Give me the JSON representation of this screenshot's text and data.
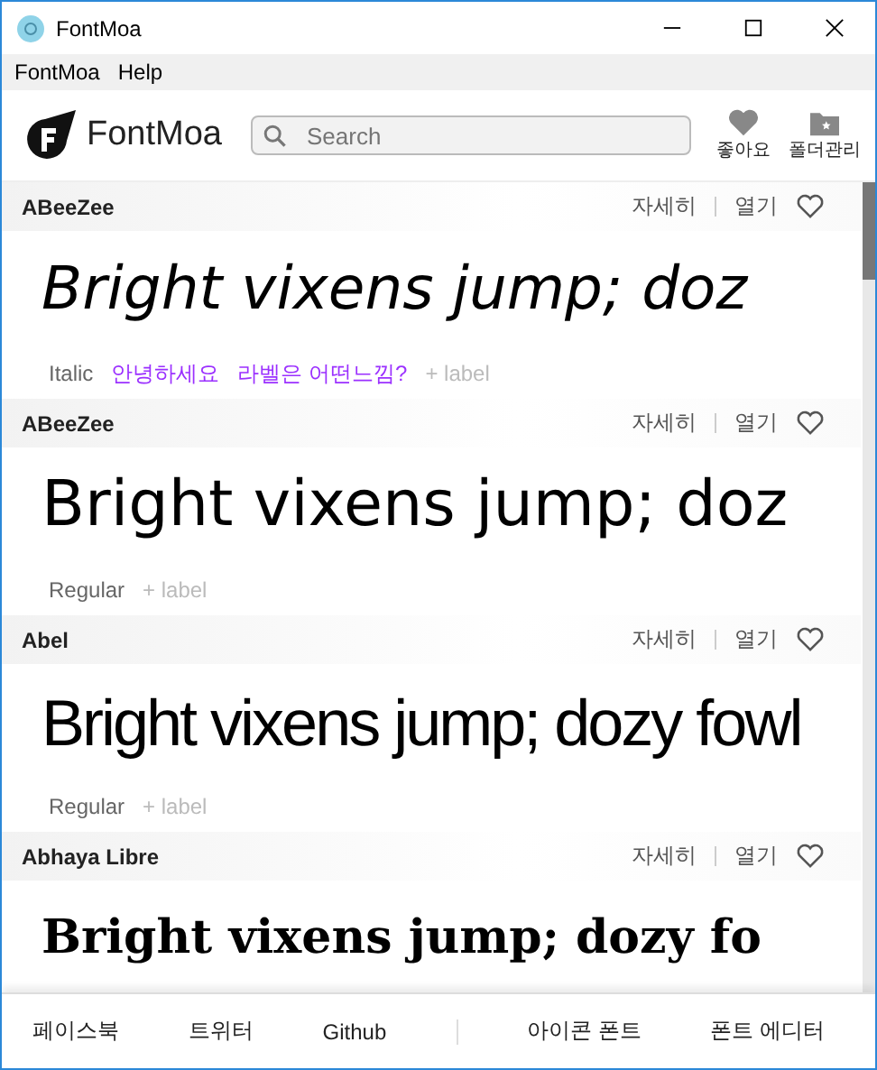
{
  "window": {
    "title": "FontMoa"
  },
  "menu": [
    "FontMoa",
    "Help"
  ],
  "header": {
    "logo": "FontMoa",
    "search": {
      "placeholder": "Search"
    },
    "actions": [
      {
        "kind": "heart",
        "label": "좋아요"
      },
      {
        "kind": "folder",
        "label": "폴더관리"
      }
    ]
  },
  "fonts": [
    {
      "name": "ABeeZee",
      "detail": "자세히",
      "open": "열기",
      "liked": false,
      "kind": "italic",
      "sample": "Bright vixens jump; doz",
      "labels": [
        {
          "kind": "style",
          "text": "Italic"
        },
        {
          "kind": "tag",
          "text": "안녕하세요"
        },
        {
          "kind": "tag",
          "text": "라벨은 어떤느낌?"
        },
        {
          "kind": "add",
          "text": "+ label"
        }
      ]
    },
    {
      "name": "ABeeZee",
      "detail": "자세히",
      "open": "열기",
      "liked": false,
      "kind": "regular",
      "sample": "Bright vixens jump; doz",
      "labels": [
        {
          "kind": "style",
          "text": "Regular"
        },
        {
          "kind": "add",
          "text": "+ label"
        }
      ]
    },
    {
      "name": "Abel",
      "detail": "자세히",
      "open": "열기",
      "liked": false,
      "kind": "condensed",
      "sample": "Bright vixens jump; dozy fowl",
      "labels": [
        {
          "kind": "style",
          "text": "Regular"
        },
        {
          "kind": "add",
          "text": "+ label"
        }
      ]
    },
    {
      "name": "Abhaya Libre",
      "detail": "자세히",
      "open": "열기",
      "liked": false,
      "kind": "serif",
      "sample": "Bright vixens jump; dozy fo"
    }
  ],
  "footer": [
    "페이스북",
    "트위터",
    "Github",
    "아이콘 폰트",
    "폰트 에디터"
  ]
}
